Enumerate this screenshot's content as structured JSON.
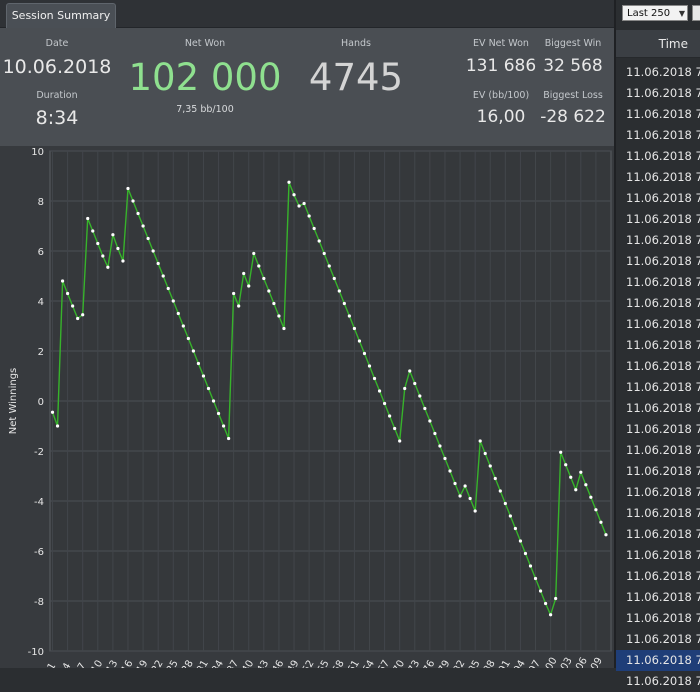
{
  "tabs": [
    {
      "label": "Session Summary"
    }
  ],
  "summary": {
    "date": {
      "label": "Date",
      "value": "10.06.2018"
    },
    "duration": {
      "label": "Duration",
      "value": "8:34"
    },
    "net_won": {
      "label": "Net Won",
      "value": "102 000",
      "sub": "7,35 bb/100"
    },
    "hands": {
      "label": "Hands",
      "value": "4745"
    },
    "ev_net_won": {
      "label": "EV Net Won",
      "value": "131 686"
    },
    "biggest_win": {
      "label": "Biggest Win",
      "value": "32 568"
    },
    "ev_bb100": {
      "label": "EV (bb/100)",
      "value": "16,00"
    },
    "biggest_loss": {
      "label": "Biggest Loss",
      "value": "-28 622"
    }
  },
  "colors": {
    "accent_green": "#8fe08f",
    "line": "#37b32b",
    "selected_row": "#1f3e78"
  },
  "side_panel": {
    "filter": {
      "selected": "Last 250"
    },
    "column_header": "Time",
    "rows": [
      "11.06.2018 7:3",
      "11.06.2018 7:3",
      "11.06.2018 7:3",
      "11.06.2018 7:3",
      "11.06.2018 7:3",
      "11.06.2018 7:3",
      "11.06.2018 7:3",
      "11.06.2018 7:3",
      "11.06.2018 7:3",
      "11.06.2018 7:3",
      "11.06.2018 7:3",
      "11.06.2018 7:3",
      "11.06.2018 7:2",
      "11.06.2018 7:2",
      "11.06.2018 7:2",
      "11.06.2018 7:2",
      "11.06.2018 7:2",
      "11.06.2018 7:2",
      "11.06.2018 7:2",
      "11.06.2018 7:2",
      "11.06.2018 7:2",
      "11.06.2018 7:2",
      "11.06.2018 7:2",
      "11.06.2018 7:2",
      "11.06.2018 7:2",
      "11.06.2018 7:2",
      "11.06.2018 7:2",
      "11.06.2018 7:2",
      "11.06.2018 7:2",
      "11.06.2018 7:2"
    ],
    "selected_index": 28
  },
  "chart_data": {
    "type": "line",
    "ylabel": "Net Winnings",
    "xlabel": "",
    "ylim": [
      -10,
      10
    ],
    "yticks": [
      10,
      8,
      6,
      4,
      2,
      0,
      -2,
      -4,
      -6,
      -8,
      -10
    ],
    "xlim": [
      0.5,
      112
    ],
    "xticks": [
      1,
      4,
      7,
      10,
      13,
      16,
      19,
      22,
      25,
      28,
      31,
      34,
      37,
      40,
      43,
      46,
      49,
      52,
      55,
      58,
      61,
      64,
      67,
      70,
      73,
      76,
      79,
      82,
      85,
      88,
      91,
      94,
      97,
      100,
      103,
      106,
      109
    ],
    "grid": true,
    "series": [
      {
        "x": [
          1,
          2,
          3,
          4,
          5,
          6,
          7,
          8,
          9,
          10,
          11,
          12,
          13,
          14,
          15,
          16,
          17,
          18,
          19,
          20,
          21,
          22,
          23,
          24,
          25,
          26,
          27,
          28,
          29,
          30,
          31,
          32,
          33,
          34,
          35,
          36,
          37,
          38,
          39,
          40,
          41,
          42,
          43,
          44,
          45,
          46,
          47,
          48,
          49,
          50,
          51,
          52,
          53,
          54,
          55,
          56,
          57,
          58,
          59,
          60,
          61,
          62,
          63,
          64,
          65,
          66,
          67,
          68,
          69,
          70,
          71,
          72,
          73,
          74,
          75,
          76,
          77,
          78,
          79,
          80,
          81,
          82,
          83,
          84,
          85,
          86,
          87,
          88,
          89,
          90,
          91,
          92,
          93,
          94,
          95,
          96,
          97,
          98,
          99,
          100,
          101,
          102,
          103,
          104,
          105,
          106,
          107,
          108,
          109,
          110,
          111
        ],
        "y": [
          -0.45,
          -1.0,
          4.8,
          4.3,
          3.8,
          3.3,
          3.45,
          7.3,
          6.8,
          6.3,
          5.8,
          5.35,
          6.65,
          6.1,
          5.6,
          8.5,
          8.0,
          7.5,
          7.0,
          6.5,
          6.0,
          5.5,
          5.0,
          4.5,
          4.0,
          3.5,
          3.0,
          2.5,
          2.0,
          1.5,
          1.0,
          0.5,
          0.0,
          -0.5,
          -1.0,
          -1.5,
          4.3,
          3.8,
          5.1,
          4.6,
          5.9,
          5.4,
          4.9,
          4.4,
          3.9,
          3.4,
          2.9,
          8.75,
          8.25,
          7.8,
          7.9,
          7.4,
          6.9,
          6.4,
          5.9,
          5.4,
          4.9,
          4.4,
          3.9,
          3.4,
          2.9,
          2.4,
          1.9,
          1.4,
          0.9,
          0.4,
          -0.1,
          -0.6,
          -1.1,
          -1.6,
          0.5,
          1.2,
          0.7,
          0.2,
          -0.3,
          -0.8,
          -1.3,
          -1.8,
          -2.3,
          -2.8,
          -3.3,
          -3.8,
          -3.4,
          -3.9,
          -4.4,
          -1.6,
          -2.1,
          -2.6,
          -3.1,
          -3.6,
          -4.1,
          -4.6,
          -5.1,
          -5.6,
          -6.1,
          -6.6,
          -7.1,
          -7.6,
          -8.1,
          -8.55,
          -7.9,
          -2.05,
          -2.55,
          -3.05,
          -3.55,
          -2.85,
          -3.35,
          -3.85,
          -4.35,
          -4.85,
          -5.35
        ]
      }
    ]
  }
}
